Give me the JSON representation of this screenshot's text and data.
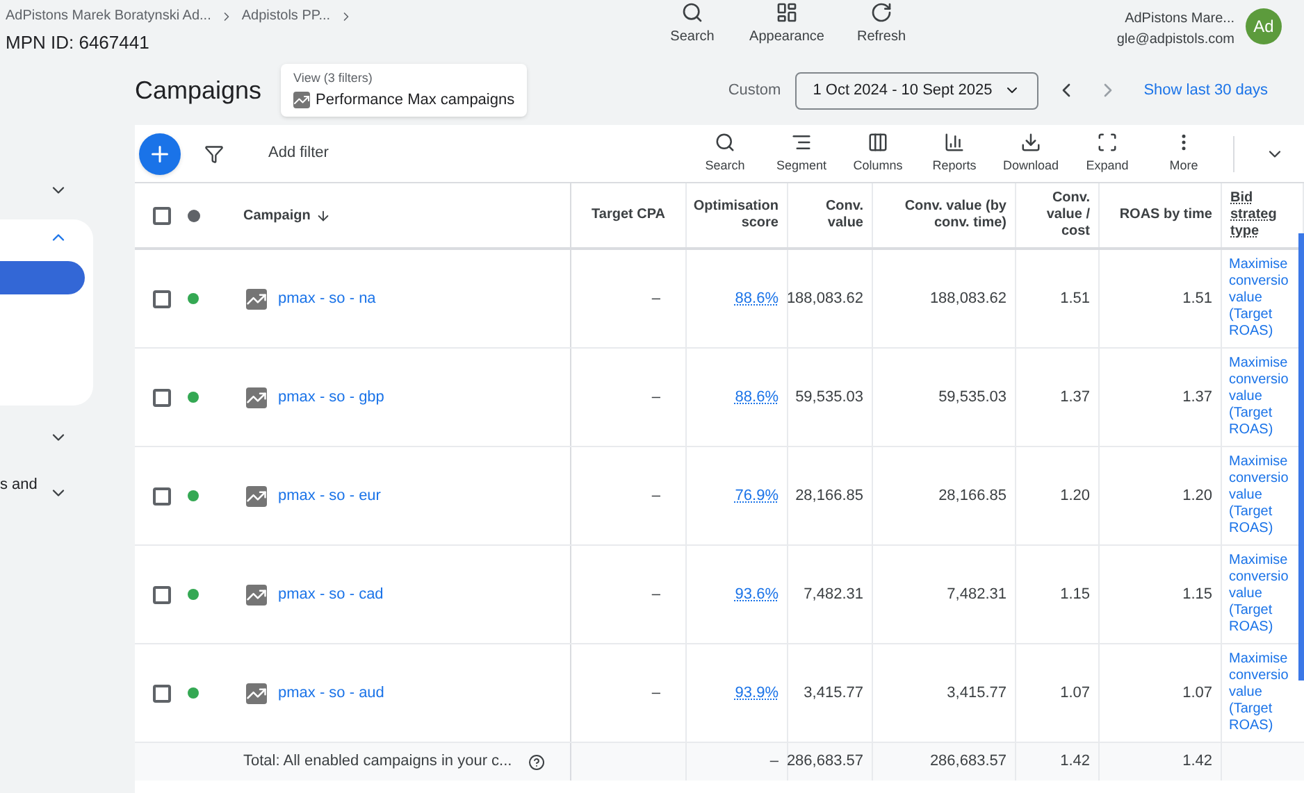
{
  "header": {
    "breadcrumbs": [
      "AdPistons Marek Boratynski Ad...",
      "Adpistols PP..."
    ],
    "mpn_id": "MPN ID: 6467441",
    "tools": [
      {
        "kind": "search",
        "label": "Search"
      },
      {
        "kind": "appearance",
        "label": "Appearance"
      },
      {
        "kind": "refresh",
        "label": "Refresh"
      }
    ],
    "account": {
      "name": "AdPistons Mare...",
      "email": "gle@adpistols.com",
      "avatar": "Ad"
    }
  },
  "sidebar": {
    "items": [
      {
        "kind": "chevron",
        "expanded": false
      },
      {
        "kind": "card",
        "expanded": true
      },
      {
        "kind": "chevron",
        "expanded": false
      },
      {
        "kind": "label",
        "label": "s and",
        "expanded": false
      }
    ]
  },
  "page": {
    "title": "Campaigns",
    "view": {
      "label": "View (3 filters)",
      "name": "Performance Max campaigns"
    },
    "date_label": "Custom",
    "date_range": "1 Oct 2024 - 10 Sept 2025",
    "show_last": "Show last 30 days"
  },
  "toolbar": {
    "add_filter": "Add filter",
    "actions": [
      {
        "kind": "search",
        "label": "Search"
      },
      {
        "kind": "segment",
        "label": "Segment"
      },
      {
        "kind": "columns",
        "label": "Columns"
      },
      {
        "kind": "reports",
        "label": "Reports"
      },
      {
        "kind": "download",
        "label": "Download"
      },
      {
        "kind": "expand",
        "label": "Expand"
      },
      {
        "kind": "more",
        "label": "More"
      }
    ]
  },
  "table": {
    "select_all_checked": false,
    "columns": [
      "Campaign",
      "Target CPA",
      "Optimisation score",
      "Conv. value",
      "Conv. value (by conv. time)",
      "Conv. value / cost",
      "ROAS by time",
      "Bid strateg type"
    ],
    "rows": [
      {
        "checked": false,
        "color": "#34a853",
        "campaign": "pmax - so - na",
        "target_cpa": "–",
        "score": "88.6%",
        "conv_value": "188,083.62",
        "conv_value_time": "188,083.62",
        "value_cost": "1.51",
        "roas_time": "1.51",
        "bid": "Maximise conversio value (Target ROAS)"
      },
      {
        "checked": false,
        "color": "#34a853",
        "campaign": "pmax - so - gbp",
        "target_cpa": "–",
        "score": "88.6%",
        "conv_value": "59,535.03",
        "conv_value_time": "59,535.03",
        "value_cost": "1.37",
        "roas_time": "1.37",
        "bid": "Maximise conversio value (Target ROAS)"
      },
      {
        "checked": false,
        "color": "#34a853",
        "campaign": "pmax - so - eur",
        "target_cpa": "–",
        "score": "76.9%",
        "conv_value": "28,166.85",
        "conv_value_time": "28,166.85",
        "value_cost": "1.20",
        "roas_time": "1.20",
        "bid": "Maximise conversio value (Target ROAS)"
      },
      {
        "checked": false,
        "color": "#34a853",
        "campaign": "pmax - so - cad",
        "target_cpa": "–",
        "score": "93.6%",
        "conv_value": "7,482.31",
        "conv_value_time": "7,482.31",
        "value_cost": "1.15",
        "roas_time": "1.15",
        "bid": "Maximise conversio value (Target ROAS)"
      },
      {
        "checked": false,
        "color": "#34a853",
        "campaign": "pmax - so - aud",
        "target_cpa": "–",
        "score": "93.9%",
        "conv_value": "3,415.77",
        "conv_value_time": "3,415.77",
        "value_cost": "1.07",
        "roas_time": "1.07",
        "bid": "Maximise conversio value (Target ROAS)"
      }
    ],
    "total": {
      "label": "Total: All enabled campaigns in your c...",
      "score": "–",
      "conv_value": "286,683.57",
      "conv_value_time": "286,683.57",
      "value_cost": "1.42",
      "roas_time": "1.42"
    }
  }
}
